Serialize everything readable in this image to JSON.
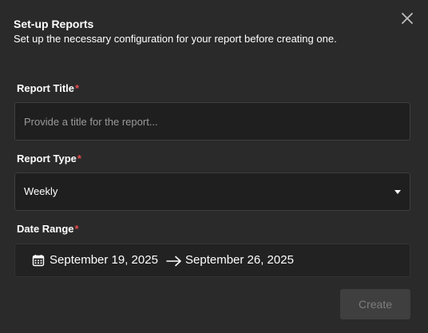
{
  "dialog": {
    "title": "Set-up Reports",
    "subtitle": "Set up the necessary configuration for your report before creating one."
  },
  "fields": {
    "report_title": {
      "label": "Report Title",
      "required_marker": "*",
      "value": "",
      "placeholder": "Provide a title for the report..."
    },
    "report_type": {
      "label": "Report Type",
      "required_marker": "*",
      "selected": "Weekly"
    },
    "date_range": {
      "label": "Date Range",
      "required_marker": "*",
      "start": "September 19, 2025",
      "end": "September 26, 2025"
    }
  },
  "actions": {
    "create_label": "Create"
  },
  "icons": {
    "close": "close-icon",
    "caret": "chevron-down-icon",
    "calendar": "calendar-icon",
    "arrow": "arrow-right-icon"
  },
  "colors": {
    "background": "#2a2a2a",
    "field_background": "#1f1f1f",
    "required": "#e5484d",
    "button_disabled_bg": "#3f3f3f",
    "button_disabled_text": "#7d7d7d"
  }
}
